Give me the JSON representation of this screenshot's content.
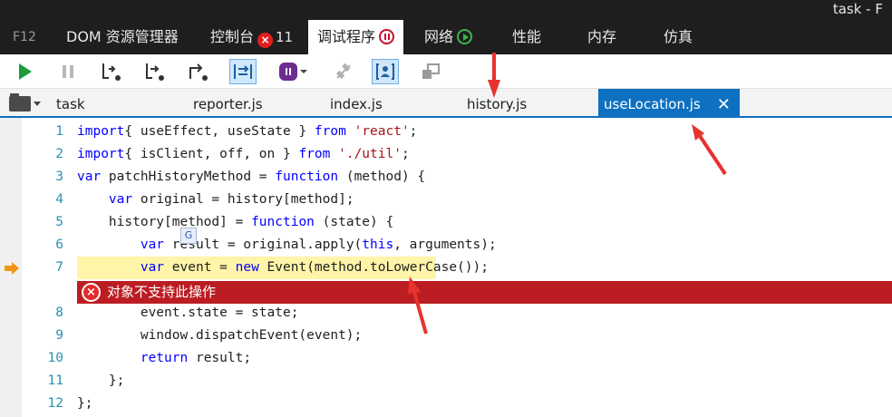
{
  "window": {
    "title": "task - F"
  },
  "tabs": {
    "f12": "F12",
    "dom": "DOM 资源管理器",
    "console": "控制台",
    "console_error_count": "11",
    "debugger": "调试程序",
    "network": "网络",
    "performance": "性能",
    "memory": "内存",
    "emulation": "仿真"
  },
  "file_tabs": {
    "items": [
      "task",
      "reporter.js",
      "index.js",
      "history.js"
    ],
    "active": "useLocation.js",
    "close": "✕"
  },
  "code": {
    "lines": [
      {
        "num": "1",
        "parts": [
          [
            "kw",
            "import"
          ],
          [
            "",
            "{ useEffect, useState } "
          ],
          [
            "kw",
            "from"
          ],
          [
            "",
            " "
          ],
          [
            "str",
            "'react'"
          ],
          [
            "",
            ";"
          ]
        ]
      },
      {
        "num": "2",
        "parts": [
          [
            "kw",
            "import"
          ],
          [
            "",
            "{ isClient, off, on } "
          ],
          [
            "kw",
            "from"
          ],
          [
            "",
            " "
          ],
          [
            "str",
            "'./util'"
          ],
          [
            "",
            ";"
          ]
        ]
      },
      {
        "num": "3",
        "parts": [
          [
            "kw",
            "var"
          ],
          [
            "",
            " patchHistoryMethod = "
          ],
          [
            "kw",
            "function"
          ],
          [
            "",
            " (method) {"
          ]
        ]
      },
      {
        "num": "4",
        "parts": [
          [
            "",
            "    "
          ],
          [
            "kw",
            "var"
          ],
          [
            "",
            " original = history[method];"
          ]
        ]
      },
      {
        "num": "5",
        "parts": [
          [
            "",
            "    history[method] = "
          ],
          [
            "kw",
            "function"
          ],
          [
            "",
            " (state) {"
          ]
        ]
      },
      {
        "num": "6",
        "parts": [
          [
            "",
            "        "
          ],
          [
            "kw",
            "var"
          ],
          [
            "",
            " result = original.apply("
          ],
          [
            "kw",
            "this"
          ],
          [
            "",
            ", arguments);"
          ]
        ]
      },
      {
        "num": "7",
        "parts": [
          [
            "",
            "        "
          ],
          [
            "kw",
            "var"
          ],
          [
            "",
            " event = "
          ],
          [
            "kw",
            "new"
          ],
          [
            "",
            " Event(method.toLowerCase());"
          ]
        ]
      },
      {
        "num": "8",
        "parts": [
          [
            "",
            "        event.state = state;"
          ]
        ]
      },
      {
        "num": "9",
        "parts": [
          [
            "",
            "        window.dispatchEvent(event);"
          ]
        ]
      },
      {
        "num": "10",
        "parts": [
          [
            "",
            "        "
          ],
          [
            "kw",
            "return"
          ],
          [
            "",
            " result;"
          ]
        ]
      },
      {
        "num": "11",
        "parts": [
          [
            "",
            "    };"
          ]
        ]
      },
      {
        "num": "12",
        "parts": [
          [
            "",
            "};"
          ]
        ]
      }
    ],
    "error_message": "对象不支持此操作",
    "current_line": "7"
  },
  "colors": {
    "keyword": "#0000ff",
    "string": "#a31515",
    "line_number": "#2b91af",
    "highlight": "#fff5a8",
    "error_bar": "#bb1d22",
    "annotation_arrow": "#e8322e"
  }
}
